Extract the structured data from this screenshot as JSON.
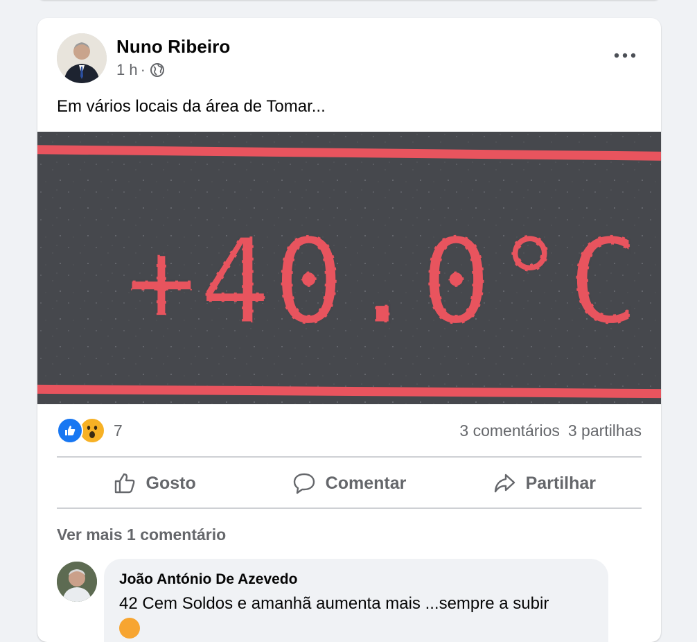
{
  "post": {
    "author": "Nuno Ribeiro",
    "time": "1 h",
    "separator": "·",
    "audience_icon": "globe-icon",
    "more_icon": "ellipsis-icon",
    "caption": "Em vários locais da área de Tomar...",
    "photo": {
      "description_icon": "thermometer-display",
      "display_text": "+40.0°C",
      "display_color": "#e8545e",
      "background_color": "#45474c"
    }
  },
  "stats": {
    "reaction_icons": [
      "like-reaction-icon",
      "wow-reaction-icon"
    ],
    "reaction_count": "7",
    "comments": "3 comentários",
    "shares": "3 partilhas"
  },
  "actions": {
    "like": "Gosto",
    "comment": "Comentar",
    "share": "Partilhar"
  },
  "comments": {
    "view_more": "Ver mais 1 comentário",
    "items": [
      {
        "author": "João António De Azevedo",
        "text": "42 Cem Soldos e amanhã aumenta mais ...sempre a subir"
      }
    ]
  },
  "colors": {
    "accent": "#1877f2",
    "secondary_text": "#65676b",
    "background": "#f0f2f5"
  }
}
